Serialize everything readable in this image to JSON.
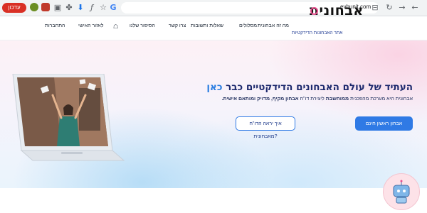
{
  "browser": {
    "update_label": "עדכון",
    "url": "evhunit.com"
  },
  "site": {
    "logo": "אבחונית",
    "tagline": "אתר האבחונות הדידקטיות",
    "nav": {
      "what": "מה זה אבחונית",
      "tracks": "מסלולים",
      "faq": "שאלות ותשובות",
      "contact": "צרו קשר",
      "story": "הסיפור שלנו",
      "personal": "לאזור האישי",
      "login": "התחברות"
    }
  },
  "hero": {
    "title_main": "העתיד של עולם האבחונים הדידקטיים כבר ",
    "title_accent": "כאן",
    "sub_a": "אבחונית היא מערכת מהפכנית ",
    "sub_b": "ממוחשבת",
    "sub_c": " ליצירת דו\"ח ",
    "sub_d": "אבחון מקיף, מדויק ומותאם אישית.",
    "primary_cta": "אבחון ראשון חינם",
    "secondary_cta": "איך יראה הדו\"ח מאבחונית?"
  },
  "colors": {
    "brand_navy": "#1e2a6e",
    "accent_blue": "#2a7de1",
    "button_blue": "#2f7ae5",
    "logo_pink": "#e74c8c"
  }
}
